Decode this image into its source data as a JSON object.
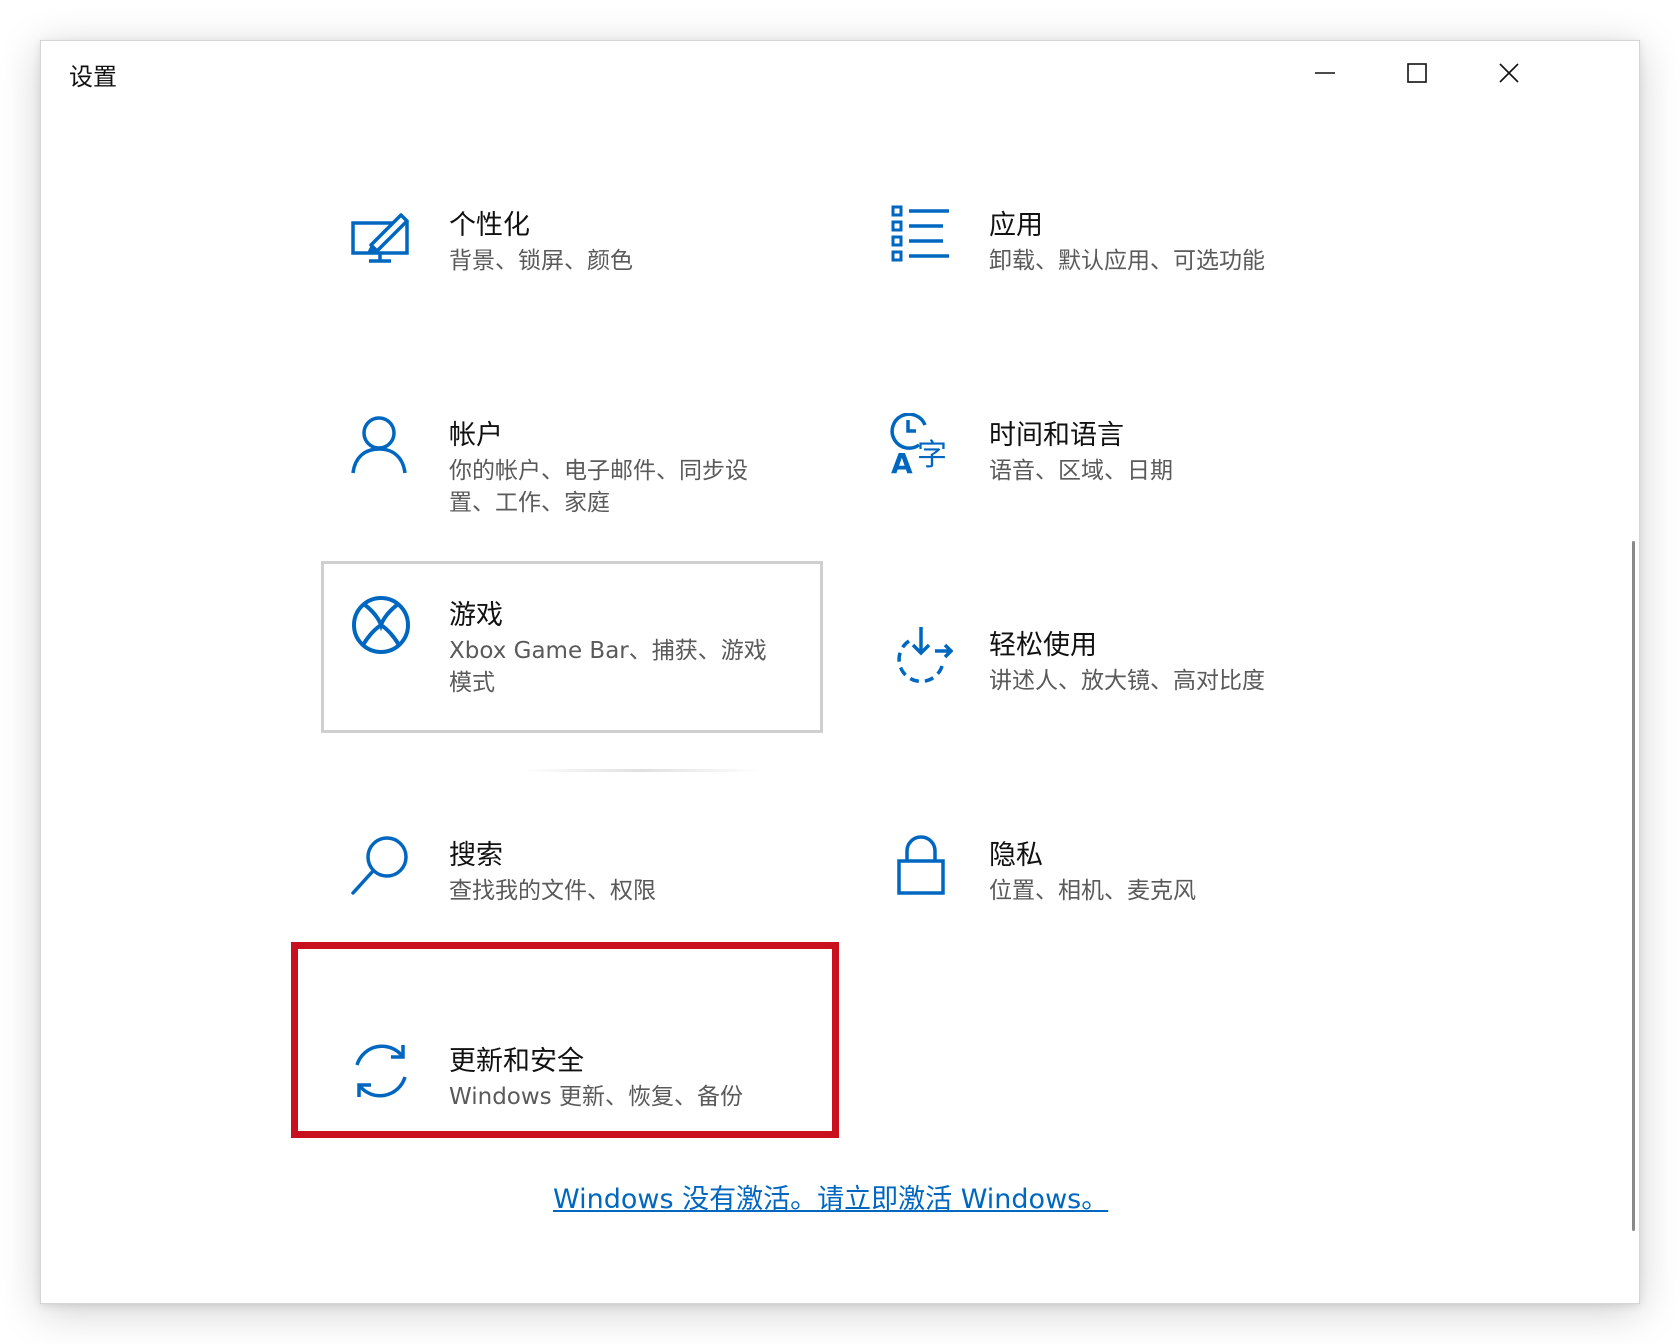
{
  "window": {
    "title": "设置",
    "minimize_label": "minimize",
    "maximize_label": "maximize",
    "close_label": "close"
  },
  "tiles": [
    {
      "name": "个性化",
      "desc": "背景、锁屏、颜色",
      "icon": "personalization-icon"
    },
    {
      "name": "应用",
      "desc": "卸载、默认应用、可选功能",
      "icon": "apps-icon"
    },
    {
      "name": "帐户",
      "desc": "你的帐户、电子邮件、同步设置、工作、家庭",
      "icon": "account-icon"
    },
    {
      "name": "时间和语言",
      "desc": "语音、区域、日期",
      "icon": "time-language-icon"
    },
    {
      "name": "游戏",
      "desc": "Xbox Game Bar、捕获、游戏模式",
      "icon": "xbox-icon"
    },
    {
      "name": "轻松使用",
      "desc": "讲述人、放大镜、高对比度",
      "icon": "ease-of-access-icon"
    },
    {
      "name": "搜索",
      "desc": "查找我的文件、权限",
      "icon": "search-icon"
    },
    {
      "name": "隐私",
      "desc": "位置、相机、麦克风",
      "icon": "lock-icon"
    },
    {
      "name": "更新和安全",
      "desc": "Windows 更新、恢复、备份",
      "icon": "sync-icon"
    }
  ],
  "activation": {
    "text": "Windows 没有激活。请立即激活 Windows。"
  },
  "colors": {
    "accent": "#0067c0",
    "highlight_box": "#c8101e"
  }
}
